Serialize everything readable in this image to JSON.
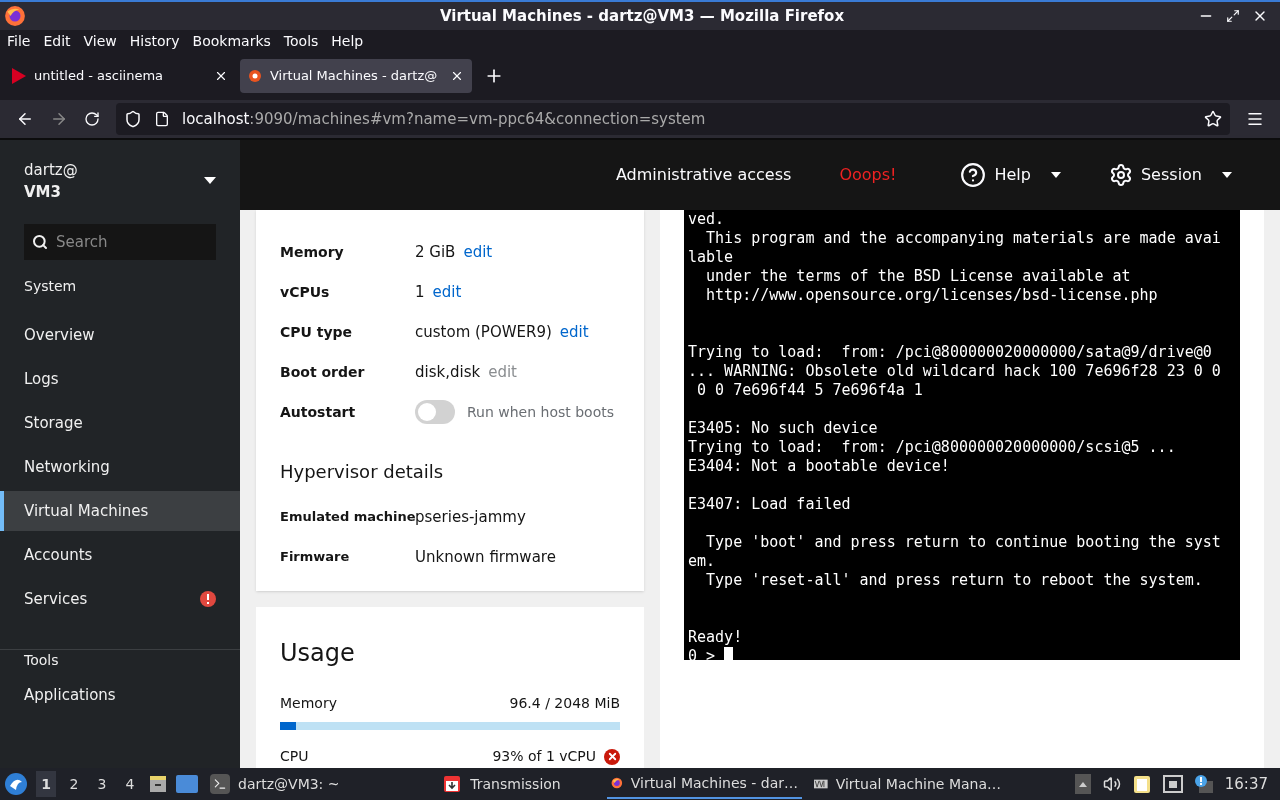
{
  "window": {
    "title": "Virtual Machines - dartz@VM3 — Mozilla Firefox"
  },
  "menu": [
    "File",
    "Edit",
    "View",
    "History",
    "Bookmarks",
    "Tools",
    "Help"
  ],
  "tabs": [
    {
      "label": "untitled - asciinema",
      "selected": false,
      "kind": "play"
    },
    {
      "label": "Virtual Machines - dartz@",
      "selected": true,
      "kind": "cockpit"
    }
  ],
  "address": {
    "host": "localhost",
    "rest": ":9090/machines#vm?name=vm-ppc64&connection=system"
  },
  "sidebar": {
    "user": "dartz@",
    "host": "VM3",
    "search": {
      "placeholder": "Search"
    },
    "groups": [
      {
        "heading": "System",
        "items": [
          {
            "label": "Overview",
            "selected": false,
            "alert": false
          },
          {
            "label": "Logs",
            "selected": false,
            "alert": false
          },
          {
            "label": "Storage",
            "selected": false,
            "alert": false
          },
          {
            "label": "Networking",
            "selected": false,
            "alert": false
          },
          {
            "label": "Virtual Machines",
            "selected": true,
            "alert": false
          },
          {
            "label": "Accounts",
            "selected": false,
            "alert": false
          },
          {
            "label": "Services",
            "selected": false,
            "alert": true
          }
        ]
      },
      {
        "heading": "Tools",
        "items": [
          {
            "label": "Applications",
            "selected": false,
            "alert": false
          }
        ]
      }
    ]
  },
  "topbar": {
    "access": "Administrative access",
    "warning": "Ooops!",
    "help": "Help",
    "session": "Session"
  },
  "overview": {
    "rows": [
      {
        "kind": "value",
        "label": "Memory",
        "value": "2 GiB",
        "edit": "edit",
        "edit_enabled": true
      },
      {
        "kind": "value",
        "label": "vCPUs",
        "value": "1",
        "edit": "edit",
        "edit_enabled": true
      },
      {
        "kind": "value",
        "label": "CPU type",
        "value": "custom (POWER9)",
        "edit": "edit",
        "edit_enabled": true
      },
      {
        "kind": "value",
        "label": "Boot order",
        "value": "disk,disk",
        "edit": "edit",
        "edit_enabled": false
      },
      {
        "kind": "switch",
        "label": "Autostart",
        "value": "Run when host boots",
        "on": false
      }
    ],
    "hypervisor": {
      "heading": "Hypervisor details",
      "rows": [
        {
          "label": "Emulated machine",
          "value": "pseries-jammy"
        },
        {
          "label": "Firmware",
          "value": "Unknown firmware"
        }
      ]
    }
  },
  "usage": {
    "heading": "Usage",
    "meters": [
      {
        "label": "Memory",
        "reading": "96.4 / 2048 MiB",
        "level": 0.047,
        "error": false
      },
      {
        "label": "CPU",
        "reading": "93% of 1 vCPU",
        "error": true
      }
    ]
  },
  "console": {
    "lines": [
      {
        "text": "ved."
      },
      {
        "text": "  This program and the accompanying materials are made avai"
      },
      {
        "text": "lable"
      },
      {
        "text": "  under the terms of the BSD License available at"
      },
      {
        "text": "  http://www.opensource.org/licenses/bsd-license.php"
      },
      {
        "kind": "blank"
      },
      {
        "kind": "blank"
      },
      {
        "text": "Trying to load:  from: /pci@800000020000000/sata@9/drive@0"
      },
      {
        "text": "... WARNING: Obsolete old wildcard hack 100 7e696f28 23 0 0"
      },
      {
        "text": " 0 0 7e696f44 5 7e696f4a 1"
      },
      {
        "kind": "blank"
      },
      {
        "text": "E3405: No such device"
      },
      {
        "text": "Trying to load:  from: /pci@800000020000000/scsi@5 ..."
      },
      {
        "text": "E3404: Not a bootable device!"
      },
      {
        "kind": "blank"
      },
      {
        "text": "E3407: Load failed"
      },
      {
        "kind": "blank"
      },
      {
        "text": "  Type 'boot' and press return to continue booting the syst"
      },
      {
        "text": "em."
      },
      {
        "text": "  Type 'reset-all' and press return to reboot the system."
      },
      {
        "kind": "blank"
      },
      {
        "kind": "blank"
      },
      {
        "text": "Ready!"
      },
      {
        "text": "0 > ",
        "cursor": true
      }
    ]
  },
  "taskbar": {
    "workspaces": [
      {
        "label": "1",
        "selected": true
      },
      {
        "label": "2",
        "selected": false
      },
      {
        "label": "3",
        "selected": false
      },
      {
        "label": "4",
        "selected": false
      }
    ],
    "tasks": [
      {
        "label": "dartz@VM3: ~",
        "kind": "terminal",
        "selected": false
      },
      {
        "label": "Transmission",
        "kind": "transmission",
        "selected": false
      },
      {
        "label": "Virtual Machines - dar…",
        "kind": "firefox",
        "selected": true
      },
      {
        "label": "Virtual Machine Mana…",
        "kind": "vmm",
        "selected": false
      }
    ],
    "clock": "16:37"
  }
}
